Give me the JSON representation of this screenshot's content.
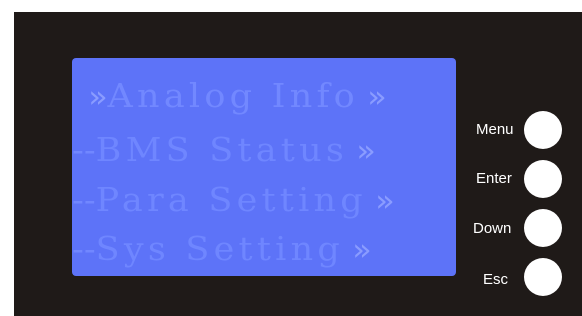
{
  "lcd": {
    "rows": [
      {
        "prefix": "",
        "chevron_left": "»",
        "label": "Analog Info",
        "chevron_right": "»"
      },
      {
        "prefix": "--",
        "chevron_left": "",
        "label": "BMS Status",
        "chevron_right": "»"
      },
      {
        "prefix": "--",
        "chevron_left": "",
        "label": "Para Setting",
        "chevron_right": "»"
      },
      {
        "prefix": "--",
        "chevron_left": "",
        "label": "Sys Setting",
        "chevron_right": "»"
      }
    ]
  },
  "buttons": {
    "menu": "Menu",
    "enter": "Enter",
    "down": "Down",
    "esc": "Esc"
  },
  "colors": {
    "panel": "#1f1a18",
    "lcd_background": "#5d73f8",
    "lcd_text": "#6d84ff",
    "button": "#ffffff"
  }
}
